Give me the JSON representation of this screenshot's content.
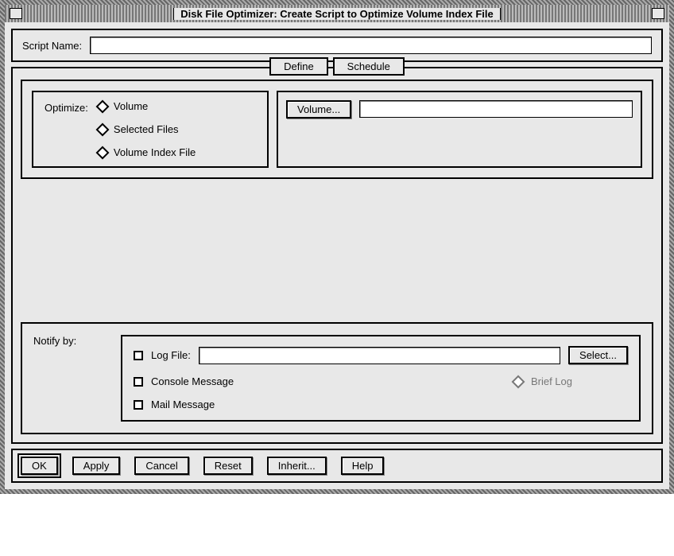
{
  "window": {
    "title": "Disk File Optimizer: Create Script to Optimize Volume Index File"
  },
  "script": {
    "label": "Script Name:",
    "value": ""
  },
  "tabs": {
    "define": "Define",
    "schedule": "Schedule"
  },
  "optimize": {
    "label": "Optimize:",
    "options": {
      "volume": "Volume",
      "selected_files": "Selected Files",
      "volume_index_file": "Volume Index File"
    }
  },
  "volume": {
    "button": "Volume...",
    "value": ""
  },
  "notify": {
    "label": "Notify by:",
    "log_file_label": "Log File:",
    "log_file_value": "",
    "select_button": "Select...",
    "console_message": "Console Message",
    "brief_log": "Brief Log",
    "mail_message": "Mail Message"
  },
  "buttons": {
    "ok": "OK",
    "apply": "Apply",
    "cancel": "Cancel",
    "reset": "Reset",
    "inherit": "Inherit...",
    "help": "Help"
  }
}
